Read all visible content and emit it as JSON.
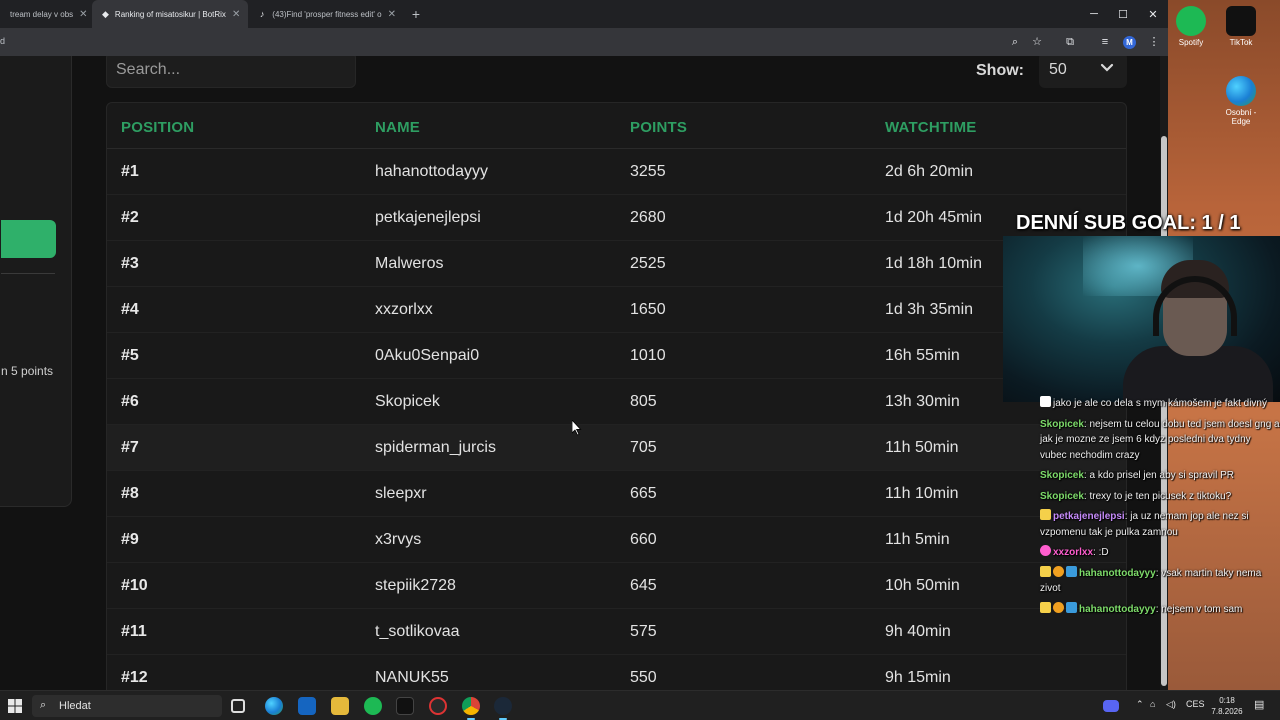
{
  "browser": {
    "tabs": [
      {
        "title": "tream delay v obs",
        "active": false
      },
      {
        "title": "Ranking of misatosikur | BotRix",
        "active": true
      },
      {
        "title": "(43)Find 'prosper fitness edit' o",
        "active": false
      }
    ],
    "address_text": "d",
    "profile_initial": "M"
  },
  "page": {
    "sidebar_text": "n 5 points",
    "search_placeholder": "Search...",
    "show_label": "Show:",
    "show_value": "50",
    "columns": [
      "POSITION",
      "NAME",
      "POINTS",
      "WATCHTIME"
    ],
    "rows": [
      {
        "position": "#1",
        "name": "hahanottodayyy",
        "points": "3255",
        "watchtime": "2d 6h 20min"
      },
      {
        "position": "#2",
        "name": "petkajenejlepsi",
        "points": "2680",
        "watchtime": "1d 20h 45min"
      },
      {
        "position": "#3",
        "name": "Malweros",
        "points": "2525",
        "watchtime": "1d 18h 10min"
      },
      {
        "position": "#4",
        "name": "xxzorlxx",
        "points": "1650",
        "watchtime": "1d 3h 35min"
      },
      {
        "position": "#5",
        "name": "0Aku0Senpai0",
        "points": "1010",
        "watchtime": "16h 55min"
      },
      {
        "position": "#6",
        "name": "Skopicek",
        "points": "805",
        "watchtime": "13h 30min"
      },
      {
        "position": "#7",
        "name": "spiderman_jurcis",
        "points": "705",
        "watchtime": "11h 50min"
      },
      {
        "position": "#8",
        "name": "sleepxr",
        "points": "665",
        "watchtime": "11h 10min"
      },
      {
        "position": "#9",
        "name": "x3rvys",
        "points": "660",
        "watchtime": "11h 5min"
      },
      {
        "position": "#10",
        "name": "stepiik2728",
        "points": "645",
        "watchtime": "10h 50min"
      },
      {
        "position": "#11",
        "name": "t_sotlikovaa",
        "points": "575",
        "watchtime": "9h 40min"
      },
      {
        "position": "#12",
        "name": "NANUK55",
        "points": "550",
        "watchtime": "9h 15min"
      }
    ],
    "accent_color": "#2e9e62"
  },
  "overlay": {
    "goal_text": "DENNÍ SUB GOAL: 1 / 1",
    "chat": [
      {
        "user": "",
        "text": "jako je ale co dela s mym kámošem je fakt divný",
        "user_color": "#9b6cff"
      },
      {
        "user": "Skopicek",
        "text": ": nejsem tu celou dobu ted jsem doesl gng a jak je mozne ze jsem 6 kdyz posledni dva tydny vubec nechodim crazy",
        "user_color": "#7ddb6a"
      },
      {
        "user": "Skopicek",
        "text": ": a kdo prisel jen aby si spravil PR",
        "user_color": "#7ddb6a"
      },
      {
        "user": "Skopicek",
        "text": ": trexy to je ten picusek z tiktoku?",
        "user_color": "#7ddb6a"
      },
      {
        "user": "petkajenejlepsi",
        "text": ": ja uz nemam jop ale nez si vzpomenu tak je pulka zamnou",
        "user_color": "#c58af9"
      },
      {
        "user": "xxzorlxx",
        "text": ": :D",
        "user_color": "#ff5ecf"
      },
      {
        "user": "hahanottodayyy",
        "text": ": vsak martin taky nema zivot",
        "user_color": "#7ddb6a"
      },
      {
        "user": "hahanottodayyy",
        "text": ": nejsem v tom sam",
        "user_color": "#7ddb6a"
      }
    ]
  },
  "desktop": {
    "icons": [
      {
        "label": "Spotify"
      },
      {
        "label": "TikTok"
      },
      {
        "label": "Osobní - Edge"
      }
    ]
  },
  "taskbar": {
    "search_label": "Hledat",
    "lang": "CES",
    "time": "0:18",
    "date": "7.8.2026"
  }
}
